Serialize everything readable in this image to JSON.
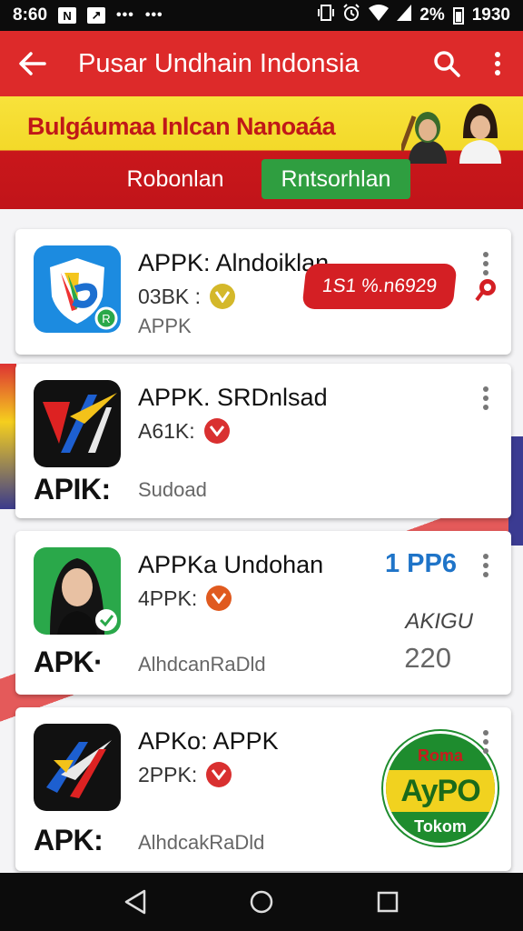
{
  "status_bar": {
    "time": "8:60",
    "signal_text": "2%",
    "battery_text": "1930",
    "notif_a": "N",
    "notif_b": "↗",
    "more_a": "•••",
    "more_b": "•••"
  },
  "app_bar": {
    "title": "Pusar Undhain Indonsia"
  },
  "hero": {
    "title": "Bulgáumaa Inlcan Nanoaáa",
    "tabs": [
      {
        "label": "Robonlan",
        "active": false
      },
      {
        "label": "Rntsorhlan",
        "active": true
      }
    ]
  },
  "apps": [
    {
      "name": "APPK: Alndoiklan",
      "meta": "03BK :",
      "sub": "APPK",
      "promo": "1S1 %.n6929",
      "badge_color": "#d4b82a"
    },
    {
      "name": "APPK. SRDnlsad",
      "meta": "A61K:",
      "icon_label": "APIK:",
      "sub": "Sudoad",
      "badge_color": "#d93030"
    },
    {
      "name": "APPKa Undohan",
      "meta": "4PPK:",
      "icon_label": "APK·",
      "sub": "AlhdcanRaDld",
      "stat_blue": "1 PP6",
      "stat_grey1": "AKIGU",
      "stat_grey2": "220",
      "badge_color": "#e05a1f"
    },
    {
      "name": "APKo: APPK",
      "meta": "2PPK:",
      "icon_label": "APK:",
      "sub": "AlhdcakRaDld",
      "round_badge": {
        "top": "Roma",
        "mid": "AyPO",
        "bottom": "Tokom"
      },
      "badge_color": "#d93030"
    }
  ],
  "colors": {
    "primary": "#dd2a2a",
    "accent_green": "#2f9e40",
    "accent_yellow": "#f3d929",
    "link_blue": "#1f74c8"
  }
}
